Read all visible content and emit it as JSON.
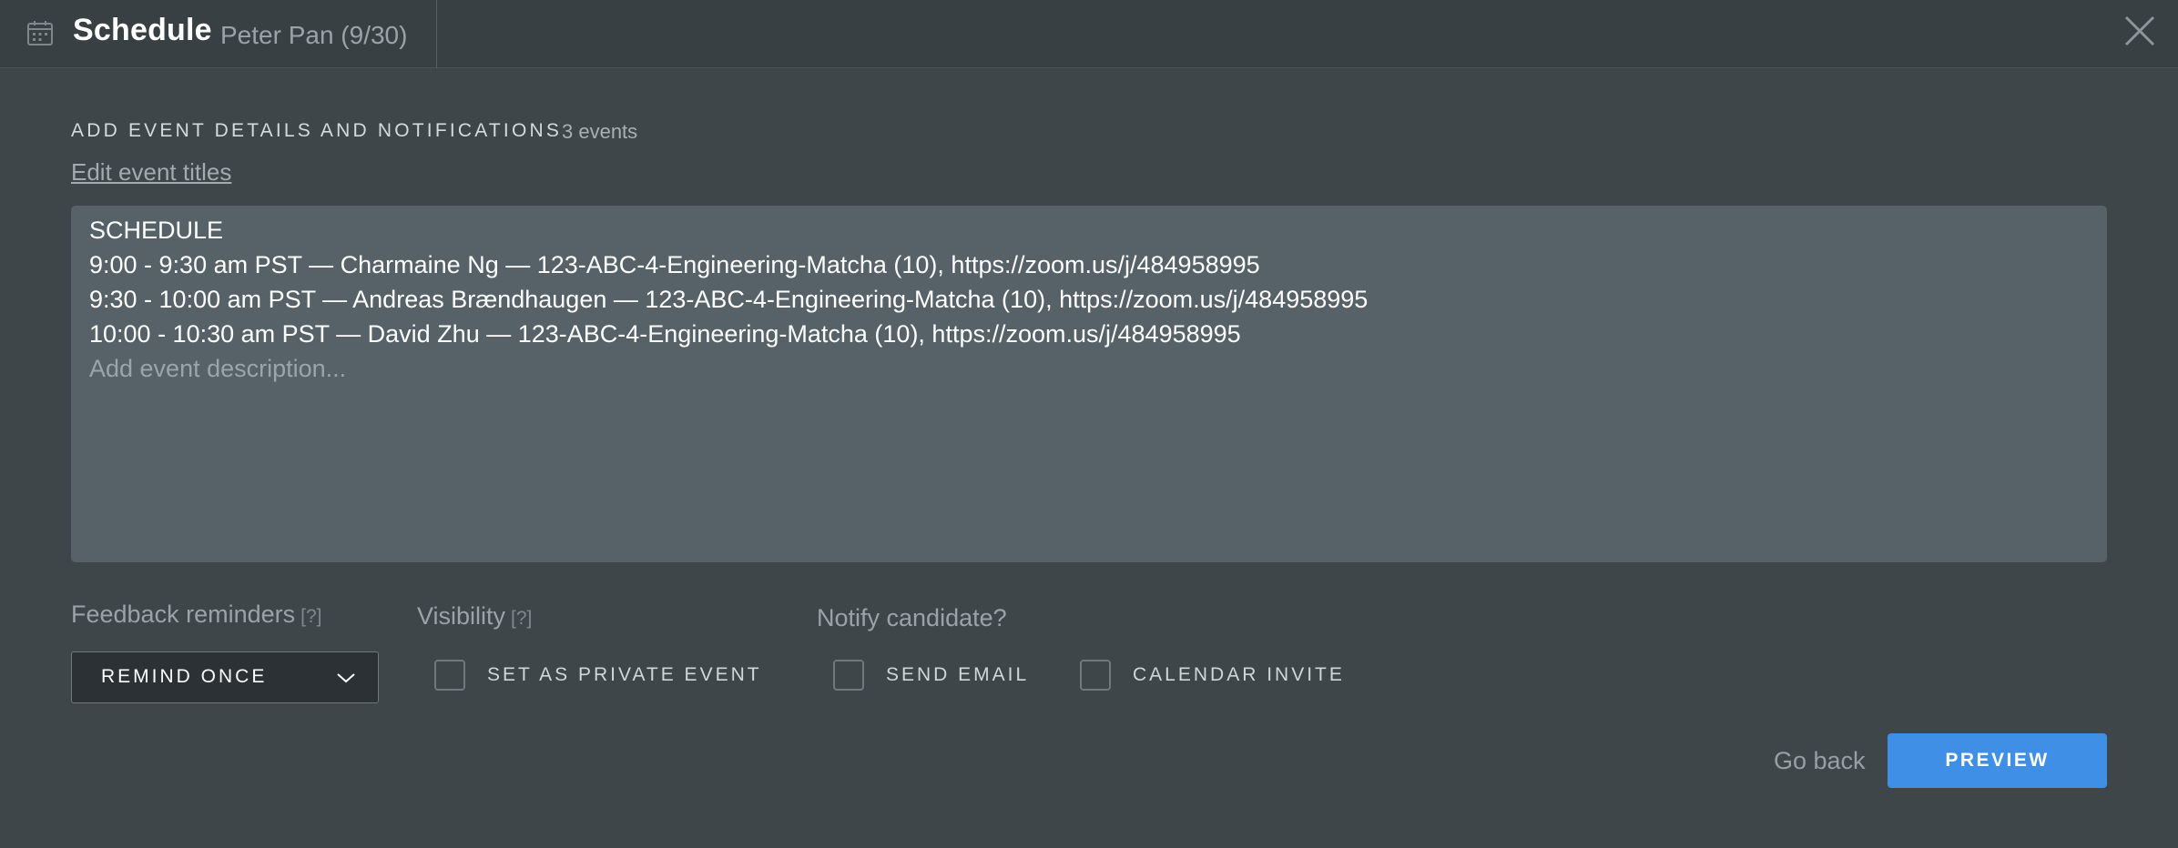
{
  "header": {
    "title": "Schedule",
    "subtitle": "Peter Pan (9/30)",
    "icon": "calendar-icon",
    "close_icon": "close-icon"
  },
  "section": {
    "heading": "ADD EVENT DETAILS AND NOTIFICATIONS",
    "count": "3 events",
    "edit_link": "Edit event titles"
  },
  "description": {
    "lines": [
      "SCHEDULE",
      "9:00 - 9:30 am PST — Charmaine Ng — 123-ABC-4-Engineering-Matcha (10), https://zoom.us/j/484958995",
      "9:30 - 10:00 am PST — Andreas Brændhaugen — 123-ABC-4-Engineering-Matcha (10), https://zoom.us/j/484958995",
      "10:00 - 10:30 am PST — David Zhu — 123-ABC-4-Engineering-Matcha (10), https://zoom.us/j/484958995"
    ],
    "placeholder": "Add event description..."
  },
  "feedback": {
    "label": "Feedback reminders",
    "help": "[?]",
    "selected": "REMIND ONCE"
  },
  "visibility": {
    "label": "Visibility",
    "help": "[?]",
    "private_label": "SET AS PRIVATE EVENT",
    "private_checked": false
  },
  "notify": {
    "label": "Notify candidate?",
    "email_label": "SEND EMAIL",
    "email_checked": false,
    "invite_label": "CALENDAR INVITE",
    "invite_checked": false
  },
  "footer": {
    "back_label": "Go back",
    "preview_label": "PREVIEW"
  },
  "colors": {
    "background": "#3e464a",
    "accent": "#3f8fe6",
    "textarea": "#566268"
  }
}
